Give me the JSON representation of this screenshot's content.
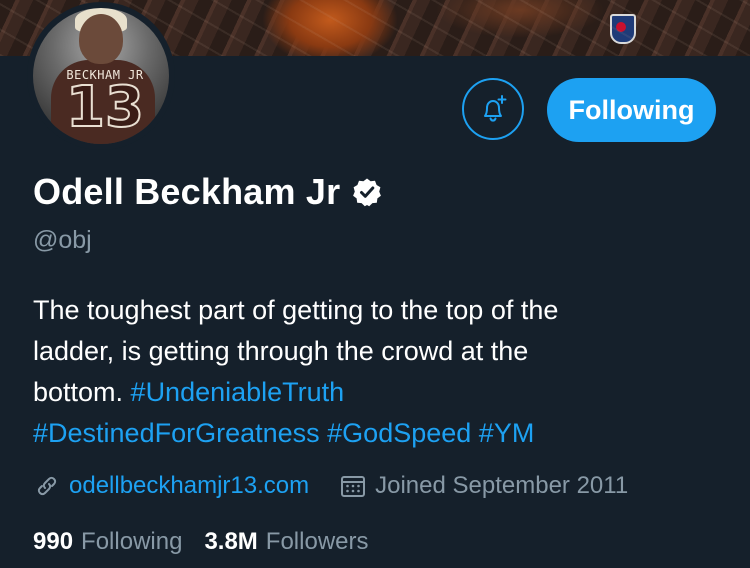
{
  "profile": {
    "name": "Odell Beckham Jr",
    "handle": "@obj",
    "verified": true,
    "avatar": {
      "jersey_name": "BECKHAM JR",
      "jersey_number": "13"
    }
  },
  "actions": {
    "notifications_icon": "bell-plus-icon",
    "follow_label": "Following"
  },
  "bio": {
    "line1": "The toughest part of getting to the top of the",
    "line2": "ladder, is getting through the crowd at the",
    "line3_text": "bottom. ",
    "hashtags": [
      "#UndeniableTruth",
      "#DestinedForGreatness",
      "#GodSpeed",
      "#YM"
    ]
  },
  "meta": {
    "website": "odellbeckhamjr13.com",
    "joined": "Joined September 2011"
  },
  "stats": {
    "following_count": "990",
    "following_label": "Following",
    "followers_count": "3.8M",
    "followers_label": "Followers"
  },
  "colors": {
    "background": "#15202b",
    "accent": "#1da1f2",
    "secondary_text": "#8899a6"
  }
}
